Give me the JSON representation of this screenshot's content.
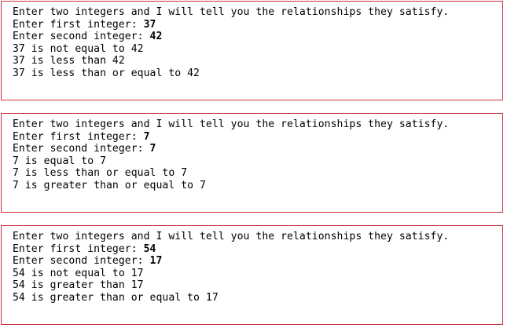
{
  "sessions": [
    {
      "prompt": "Enter two integers and I will tell you the relationships they satisfy.",
      "first_label": "Enter first integer: ",
      "first_value": "37",
      "second_label": "Enter second integer: ",
      "second_value": "42",
      "results": [
        "37 is not equal to 42",
        "37 is less than 42",
        "37 is less than or equal to 42"
      ]
    },
    {
      "prompt": "Enter two integers and I will tell you the relationships they satisfy.",
      "first_label": "Enter first integer: ",
      "first_value": "7",
      "second_label": "Enter second integer: ",
      "second_value": "7",
      "results": [
        "7 is equal to 7",
        "7 is less than or equal to 7",
        "7 is greater than or equal to 7"
      ]
    },
    {
      "prompt": "Enter two integers and I will tell you the relationships they satisfy.",
      "first_label": "Enter first integer: ",
      "first_value": "54",
      "second_label": "Enter second integer: ",
      "second_value": "17",
      "results": [
        "54 is not equal to 17",
        "54 is greater than 17",
        "54 is greater than or equal to 17"
      ]
    }
  ],
  "colors": {
    "border": "#c8313a",
    "text": "#000000",
    "background": "#ffffff"
  }
}
